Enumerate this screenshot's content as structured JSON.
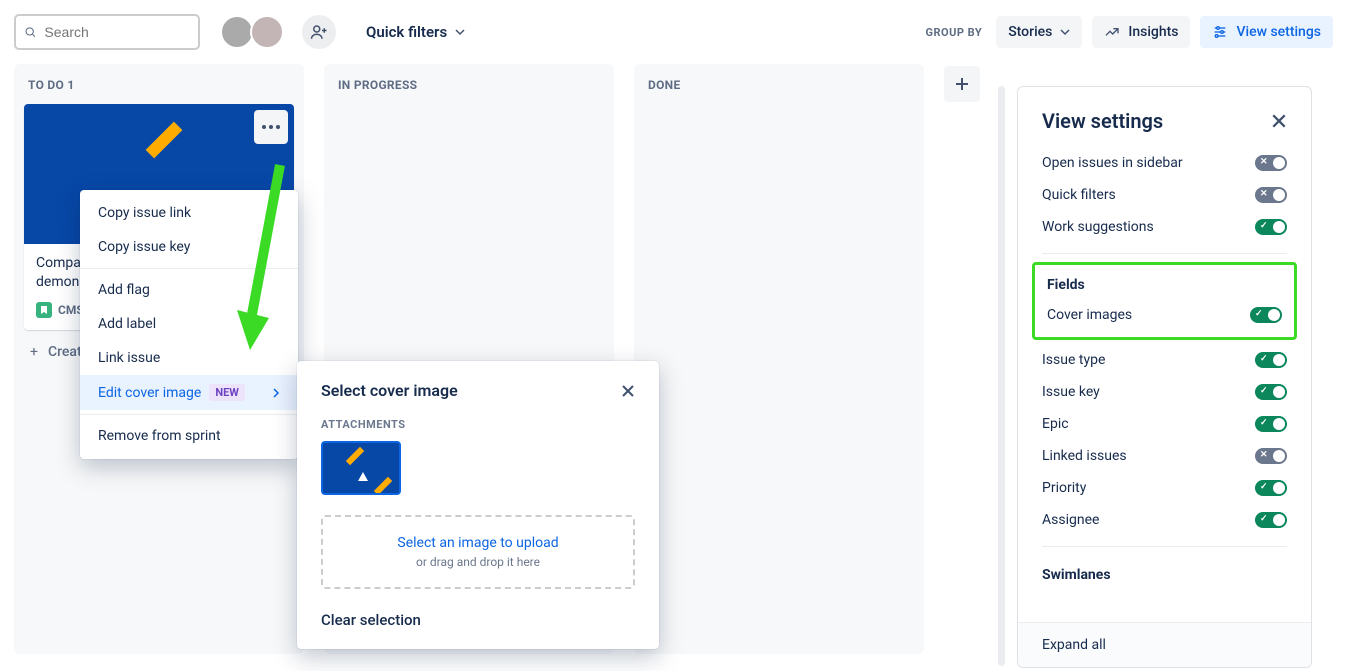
{
  "topbar": {
    "search_placeholder": "Search",
    "quick_filters": "Quick filters",
    "group_by_label": "GROUP BY",
    "group_by_value": "Stories",
    "insights": "Insights",
    "view_settings": "View settings"
  },
  "columns": {
    "todo": {
      "title": "TO DO 1"
    },
    "in_progress": {
      "title": "IN PROGRESS"
    },
    "done": {
      "title": "DONE"
    }
  },
  "card": {
    "title_prefix": "Compar",
    "title_line2": "demons",
    "key_prefix": "CMS"
  },
  "create_label": "Creat",
  "dropdown": {
    "copy_link": "Copy issue link",
    "copy_key": "Copy issue key",
    "add_flag": "Add flag",
    "add_label": "Add label",
    "link_issue": "Link issue",
    "edit_cover": "Edit cover image",
    "new_badge": "NEW",
    "remove_sprint": "Remove from sprint"
  },
  "popover": {
    "title": "Select cover image",
    "attachments": "ATTACHMENTS",
    "upload_link": "Select an image to upload",
    "upload_hint": "or drag and drop it here",
    "clear": "Clear selection"
  },
  "panel": {
    "title": "View settings",
    "open_sidebar": "Open issues in sidebar",
    "quick_filters": "Quick filters",
    "work_suggestions": "Work suggestions",
    "fields_section": "Fields",
    "cover_images": "Cover images",
    "issue_type": "Issue type",
    "issue_key": "Issue key",
    "epic": "Epic",
    "linked_issues": "Linked issues",
    "priority": "Priority",
    "assignee": "Assignee",
    "swimlanes": "Swimlanes",
    "expand_all": "Expand all"
  }
}
